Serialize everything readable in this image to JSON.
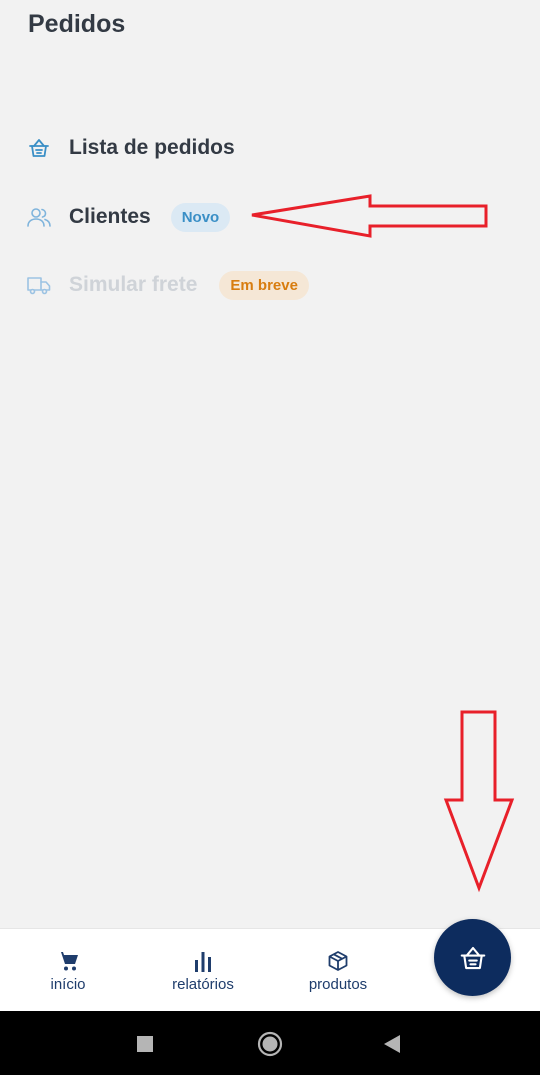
{
  "page": {
    "title": "Pedidos"
  },
  "menu": {
    "items": [
      {
        "label": "Lista de pedidos",
        "icon": "basket-icon",
        "enabled": true
      },
      {
        "label": "Clientes",
        "icon": "users-icon",
        "enabled": true,
        "badge": "Novo"
      },
      {
        "label": "Simular frete",
        "icon": "truck-icon",
        "enabled": false,
        "badge": "Em breve"
      }
    ]
  },
  "bottom_nav": {
    "tabs": [
      {
        "label": "início",
        "icon": "cart-icon"
      },
      {
        "label": "relatórios",
        "icon": "bar-chart-icon"
      },
      {
        "label": "produtos",
        "icon": "box-icon"
      }
    ],
    "fab_icon": "basket-icon"
  },
  "system_nav": {
    "icons": [
      "recents-square-icon",
      "home-circle-icon",
      "back-triangle-icon"
    ]
  },
  "colors": {
    "background": "#f2f2f2",
    "text_primary": "#333a44",
    "text_disabled": "#cfd3d8",
    "accent_blue": "#3a8fc6",
    "badge_new_bg": "#dbe9f4",
    "badge_soon_bg": "#f5e7d6",
    "badge_soon_text": "#d87d10",
    "nav_dark": "#0d2c5e",
    "annotation_red": "#e8202a"
  }
}
